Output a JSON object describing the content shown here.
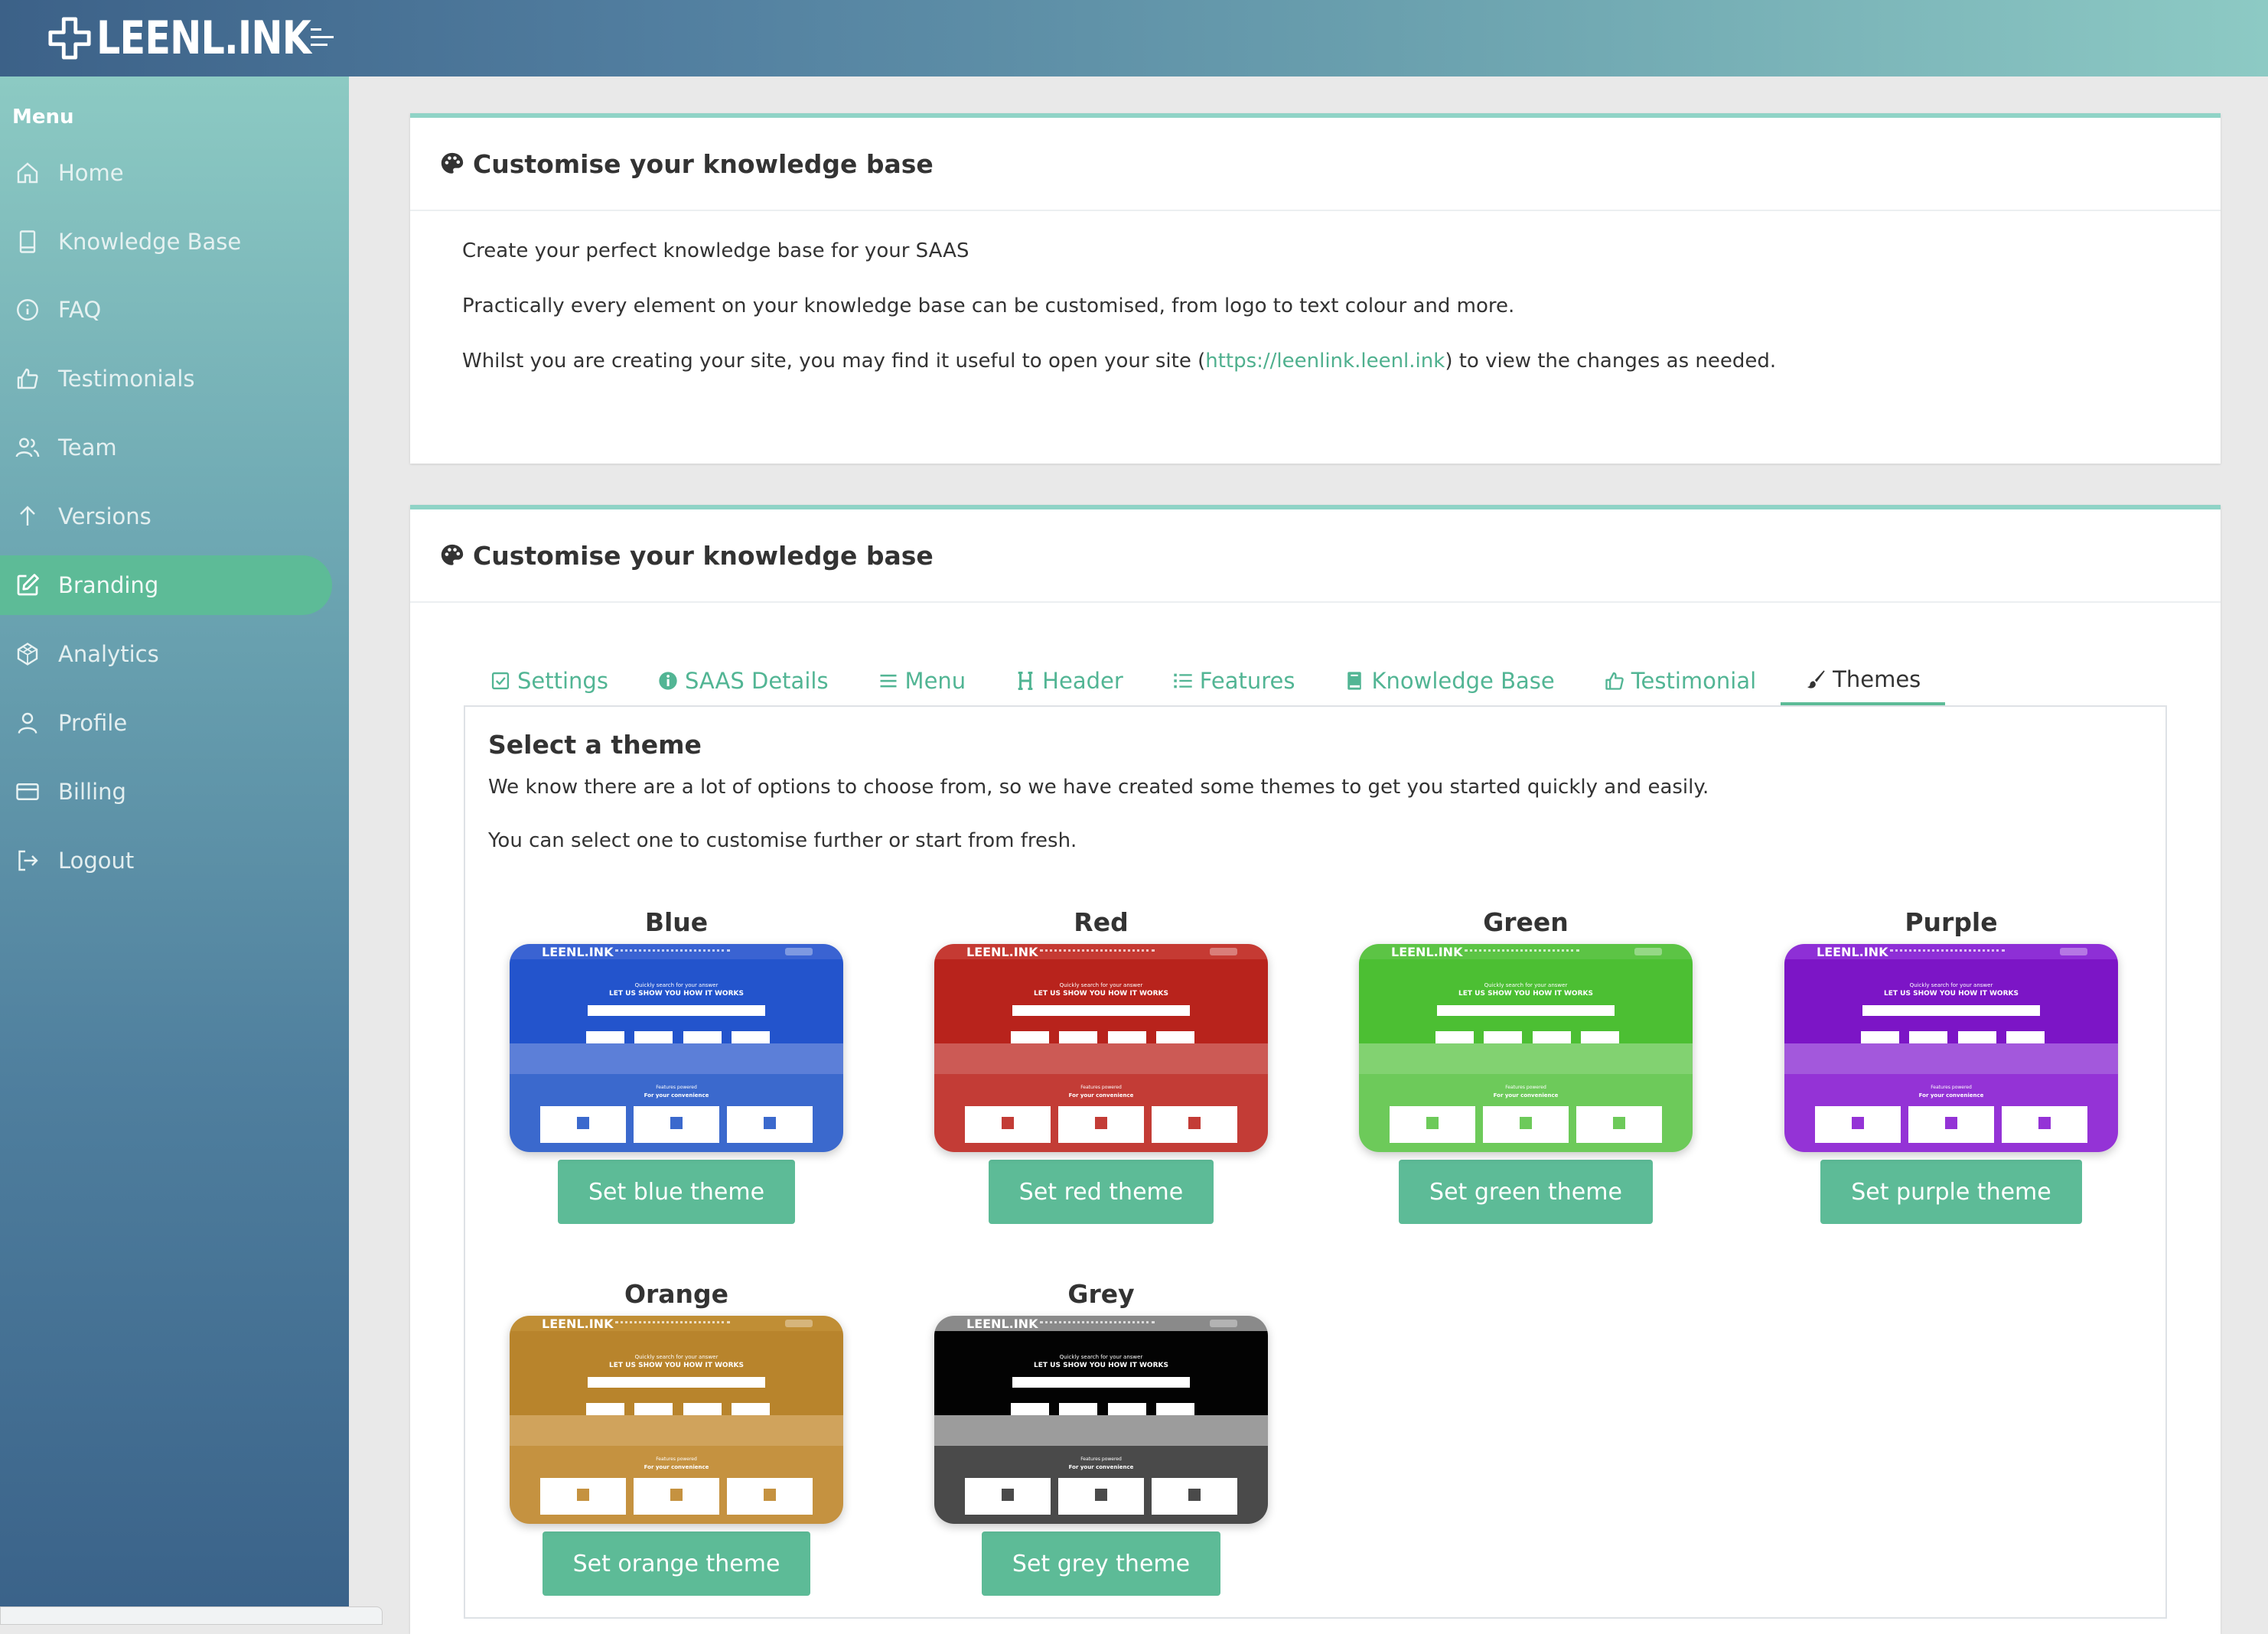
{
  "app": {
    "logo_text": "LEENL.INK"
  },
  "sidebar": {
    "menu_label": "Menu",
    "items": [
      {
        "label": "Home",
        "icon": "home-icon"
      },
      {
        "label": "Knowledge Base",
        "icon": "book-icon"
      },
      {
        "label": "FAQ",
        "icon": "info-icon"
      },
      {
        "label": "Testimonials",
        "icon": "thumbs-up-icon"
      },
      {
        "label": "Team",
        "icon": "users-icon"
      },
      {
        "label": "Versions",
        "icon": "arrow-up-icon"
      },
      {
        "label": "Branding",
        "icon": "edit-icon",
        "active": true
      },
      {
        "label": "Analytics",
        "icon": "globe-icon"
      },
      {
        "label": "Profile",
        "icon": "user-icon"
      },
      {
        "label": "Billing",
        "icon": "credit-card-icon"
      },
      {
        "label": "Logout",
        "icon": "logout-icon"
      }
    ]
  },
  "intro_card": {
    "title": "Customise your knowledge base",
    "line1": "Create your perfect knowledge base for your SAAS",
    "line2": "Practically every element on your knowledge base can be customised, from logo to text colour and more.",
    "line3_pre": "Whilst you are creating your site, you may find it useful to open your site (",
    "line3_link": "https://leenlink.leenl.ink",
    "line3_post": ") to view the changes as needed."
  },
  "settings_card": {
    "title": "Customise your knowledge base",
    "tabs": [
      {
        "label": "Settings",
        "icon": "checkbox-icon"
      },
      {
        "label": "SAAS Details",
        "icon": "info-circle-icon"
      },
      {
        "label": "Menu",
        "icon": "menu-icon"
      },
      {
        "label": "Header",
        "icon": "heading-icon"
      },
      {
        "label": "Features",
        "icon": "list-icon"
      },
      {
        "label": "Knowledge Base",
        "icon": "book-icon"
      },
      {
        "label": "Testimonial",
        "icon": "thumbs-up-icon"
      },
      {
        "label": "Themes",
        "icon": "brush-icon",
        "active": true
      }
    ],
    "panel": {
      "title": "Select a theme",
      "text1": "We know there are a lot of options to choose from, so we have created some themes to get you started quickly and easily.",
      "text2": "You can select one to customise further or start from fresh."
    },
    "themes": [
      {
        "name": "Blue",
        "button": "Set blue theme",
        "colors": {
          "nav": "#3a63d2",
          "hero": "#2354cc",
          "band": "#5c7fd8",
          "bottom": "#3b69cd",
          "icon": "#3b69cd"
        }
      },
      {
        "name": "Red",
        "button": "Set red theme",
        "colors": {
          "nav": "#c53a33",
          "hero": "#b8231c",
          "band": "#cc5a55",
          "bottom": "#c33c36",
          "icon": "#c33c36"
        }
      },
      {
        "name": "Green",
        "button": "Set green theme",
        "colors": {
          "nav": "#5cc445",
          "hero": "#4cbf33",
          "band": "#82d271",
          "bottom": "#6dca5a",
          "icon": "#6dca5a"
        }
      },
      {
        "name": "Purple",
        "button": "Set purple theme",
        "colors": {
          "nav": "#8e2fd6",
          "hero": "#7c15c6",
          "band": "#a358dc",
          "bottom": "#9433d6",
          "icon": "#9433d6"
        }
      },
      {
        "name": "Orange",
        "button": "Set orange theme",
        "colors": {
          "nav": "#c08e35",
          "hero": "#b8842c",
          "band": "#d0a35c",
          "bottom": "#c59240",
          "icon": "#c59240"
        }
      },
      {
        "name": "Grey",
        "button": "Set grey theme",
        "colors": {
          "nav": "#8a8a8a",
          "hero": "#030303",
          "band": "#9c9c9c",
          "bottom": "#4a4a4a",
          "icon": "#4a4a4a"
        }
      }
    ],
    "thumbnail_text": {
      "logo": "LEENL.INK",
      "hero_small": "Quickly search for your answer",
      "hero_big": "LET US SHOW YOU HOW IT WORKS",
      "bottom_small": "Features powered",
      "bottom_big": "For your convenience"
    }
  }
}
